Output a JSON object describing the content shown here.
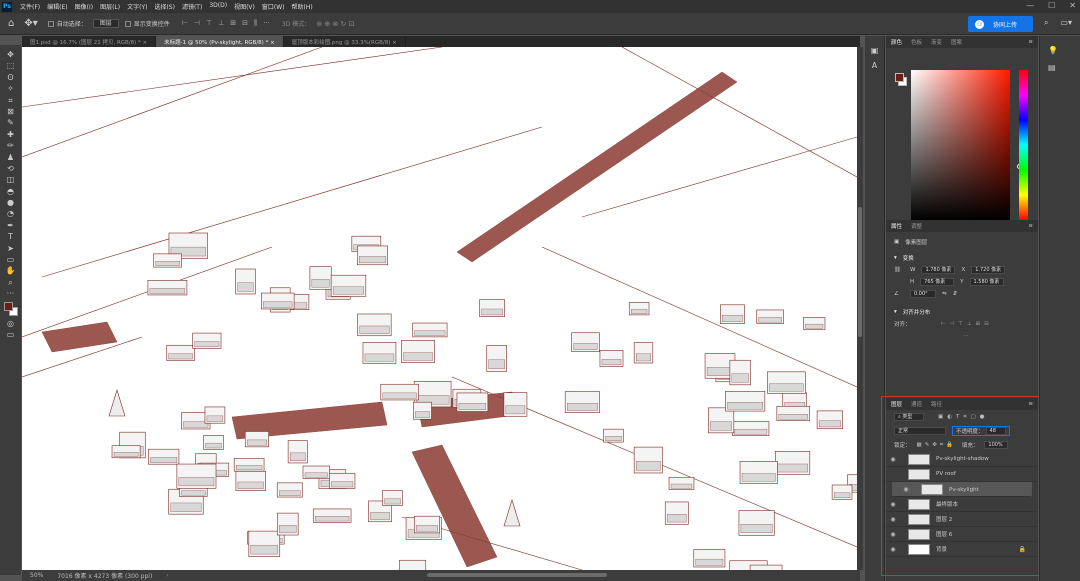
{
  "app": {
    "logo": "Ps",
    "menu": [
      "文件(F)",
      "编辑(E)",
      "图像(I)",
      "图层(L)",
      "文字(Y)",
      "选择(S)",
      "滤镜(T)",
      "3D(D)",
      "视图(V)",
      "窗口(W)",
      "帮助(H)"
    ],
    "window_controls": [
      "—",
      "☐",
      "✕"
    ]
  },
  "options_bar": {
    "auto_select_label": "自动选择：",
    "auto_select_value": "图层",
    "show_transform_label": "显示变换控件",
    "mode_3d_label": "3D 模式：",
    "share_button": "协同上传"
  },
  "tabs": [
    {
      "label": "图1.psd @ 16.7% (图层 21 拷贝, RGB/8) *  ×",
      "active": false
    },
    {
      "label": "未标题-1 @ 50% (Pv-skylight, RGB/8) *  ×",
      "active": true
    },
    {
      "label": "屋顶版本彩绘图.png @ 33.3%(RGB/8)  ×",
      "active": false
    }
  ],
  "tools": [
    "move-icon",
    "marquee-icon",
    "lasso-icon",
    "magic-wand-icon",
    "crop-icon",
    "frame-icon",
    "eyedropper-icon",
    "healing-icon",
    "brush-icon",
    "stamp-icon",
    "history-brush-icon",
    "eraser-icon",
    "bucket-icon",
    "blur-icon",
    "dodge-icon",
    "pen-icon",
    "type-icon",
    "path-select-icon",
    "shape-icon",
    "hand-icon",
    "zoom-icon",
    "more-icon"
  ],
  "tool_glyphs": [
    "✥",
    "⬚",
    "ʘ",
    "✧",
    "⌗",
    "⊠",
    "✎",
    "✚",
    "✏",
    "♟",
    "⟲",
    "◫",
    "◓",
    "●",
    "◔",
    "✒",
    "T",
    "➤",
    "▭",
    "✋",
    "⌕",
    "···"
  ],
  "colors": {
    "foreground": "#6f1d14",
    "background": "#ffffff",
    "accent": "#1473e6",
    "highlight_box": "#c0392b",
    "canvas_stroke": "#7a2a22"
  },
  "status_bar": {
    "zoom": "50%",
    "doc_info": "7016 像素 x 4273 像素 (300 ppi)"
  },
  "color_panel": {
    "tabs": [
      "颜色",
      "色板",
      "渐变",
      "图案"
    ],
    "active_tab": "颜色"
  },
  "properties_panel": {
    "tabs": [
      "属性",
      "调整"
    ],
    "active_tab": "属性",
    "layer_type": "像素图层",
    "transform_title": "变换",
    "w_label": "W",
    "w_value": "1.780 像素",
    "x_label": "X",
    "x_value": "1.720 像素",
    "h_label": "H",
    "h_value": "765 像素",
    "y_label": "Y",
    "y_value": "1.580 像素",
    "angle_value": "0.00°",
    "align_title": "对齐并分布",
    "align_label": "对齐："
  },
  "layers_panel": {
    "tabs": [
      "图层",
      "通道",
      "路径"
    ],
    "active_tab": "图层",
    "filter_kind": "类型",
    "blend_mode": "正常",
    "opacity_label": "不透明度：",
    "opacity_value": "48",
    "lock_label": "锁定：",
    "fill_label": "填充：",
    "fill_value": "100%",
    "layers": [
      {
        "name": "Pv-skylight-shadow",
        "selected": false,
        "visible": true
      },
      {
        "name": "PV roof",
        "selected": false,
        "visible": false
      },
      {
        "name": "Pv-skylight",
        "selected": true,
        "visible": true
      },
      {
        "name": "最终版本",
        "selected": false,
        "visible": true
      },
      {
        "name": "图层 2",
        "selected": false,
        "visible": true
      },
      {
        "name": "图层 6",
        "selected": false,
        "visible": true
      },
      {
        "name": "背景",
        "selected": false,
        "visible": true,
        "locked": true
      }
    ]
  }
}
